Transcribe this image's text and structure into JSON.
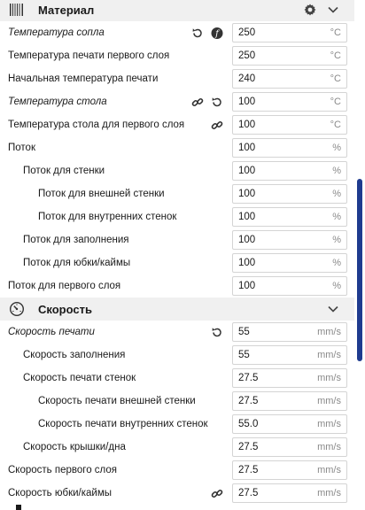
{
  "material": {
    "title": "Материал",
    "rows": [
      {
        "label": "Температура сопла",
        "value": "250",
        "unit": "°C"
      },
      {
        "label": "Температура печати первого слоя",
        "value": "250",
        "unit": "°C"
      },
      {
        "label": "Начальная температура печати",
        "value": "240",
        "unit": "°C"
      },
      {
        "label": "Температура стола",
        "value": "100",
        "unit": "°C"
      },
      {
        "label": "Температура стола для первого слоя",
        "value": "100",
        "unit": "°C"
      },
      {
        "label": "Поток",
        "value": "100",
        "unit": "%"
      },
      {
        "label": "Поток для стенки",
        "value": "100",
        "unit": "%"
      },
      {
        "label": "Поток для внешней стенки",
        "value": "100",
        "unit": "%"
      },
      {
        "label": "Поток для внутренних стенок",
        "value": "100",
        "unit": "%"
      },
      {
        "label": "Поток для заполнения",
        "value": "100",
        "unit": "%"
      },
      {
        "label": "Поток для юбки/каймы",
        "value": "100",
        "unit": "%"
      },
      {
        "label": "Поток для первого слоя",
        "value": "100",
        "unit": "%"
      }
    ]
  },
  "speed": {
    "title": "Скорость",
    "rows": [
      {
        "label": "Скорость печати",
        "value": "55",
        "unit": "mm/s"
      },
      {
        "label": "Скорость заполнения",
        "value": "55",
        "unit": "mm/s"
      },
      {
        "label": "Скорость печати стенок",
        "value": "27.5",
        "unit": "mm/s"
      },
      {
        "label": "Скорость печати внешней стенки",
        "value": "27.5",
        "unit": "mm/s"
      },
      {
        "label": "Скорость печати внутренних стенок",
        "value": "55.0",
        "unit": "mm/s"
      },
      {
        "label": "Скорость крышки/дна",
        "value": "27.5",
        "unit": "mm/s"
      },
      {
        "label": "Скорость первого слоя",
        "value": "27.5",
        "unit": "mm/s"
      },
      {
        "label": "Скорость юбки/каймы",
        "value": "27.5",
        "unit": "mm/s"
      }
    ]
  },
  "icons": {
    "material_section": "spool-icon",
    "speed_section": "speedometer-icon",
    "settings": "gear-icon",
    "collapse": "chevron-down-icon",
    "reset": "reset-icon",
    "function": "function-icon",
    "linked": "link-icon"
  },
  "colors": {
    "section_bg": "#f0f0f0",
    "field_border": "#d4d4d4",
    "unit_text": "#8a8a8a",
    "scrollbar": "#1f3b8f"
  }
}
